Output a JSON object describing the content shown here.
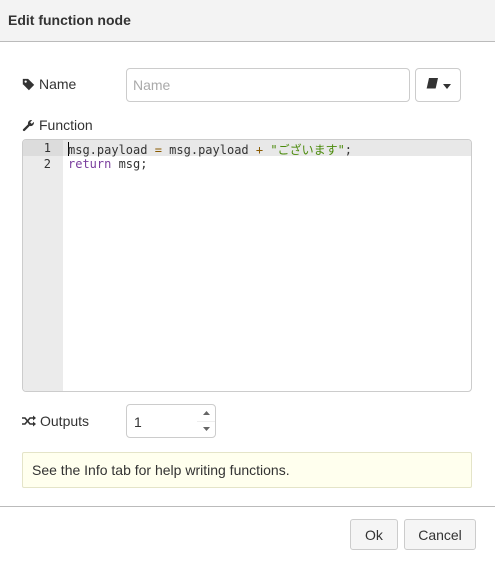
{
  "dialog": {
    "title": "Edit function node"
  },
  "name_field": {
    "label": "Name",
    "value": "",
    "placeholder": "Name"
  },
  "library_button": {
    "icon": "book-icon"
  },
  "function_field": {
    "label": "Function",
    "line_numbers": [
      "1",
      "2"
    ],
    "lines": [
      {
        "t1": "msg.payload",
        "t2": " = ",
        "t3": "msg.payload",
        "t4": " + ",
        "t5": "\"ございます\"",
        "t6": ";"
      },
      {
        "kw": "return",
        "rest": " msg;"
      }
    ]
  },
  "outputs_field": {
    "label": "Outputs",
    "value": "1"
  },
  "tip": {
    "text": "See the Info tab for help writing functions."
  },
  "buttons": {
    "ok": "Ok",
    "cancel": "Cancel"
  }
}
